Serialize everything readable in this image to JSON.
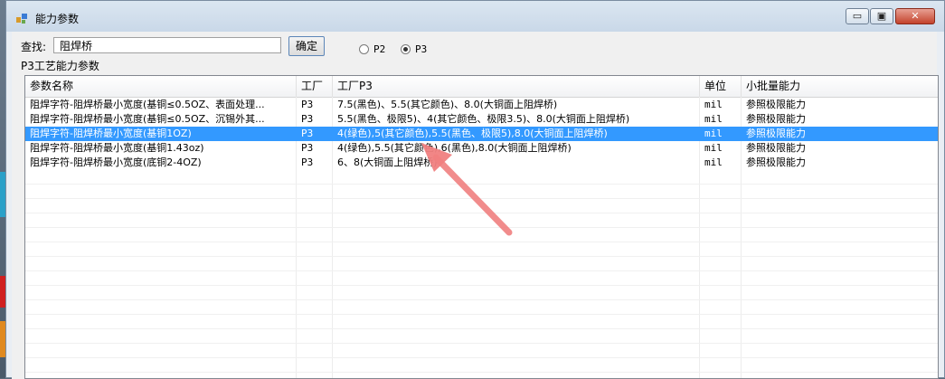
{
  "window": {
    "title": "能力参数",
    "controls": {
      "minimize": "▭",
      "maximize": "▣",
      "close": "✕"
    }
  },
  "search": {
    "label": "查找:",
    "value": "阻焊桥",
    "confirm_label": "确定"
  },
  "radios": [
    {
      "label": "P2",
      "checked": false
    },
    {
      "label": "P3",
      "checked": true
    }
  ],
  "section_label": "P3工艺能力参数",
  "table": {
    "columns": [
      "参数名称",
      "工厂",
      "工厂P3",
      "单位",
      "小批量能力"
    ],
    "rows": [
      [
        "阻焊字符-阻焊桥最小宽度(基铜≤0.5OZ、表面处理...",
        "P3",
        "7.5(黑色)、5.5(其它颜色)、8.0(大铜面上阻焊桥)",
        "mil",
        "参照极限能力"
      ],
      [
        "阻焊字符-阻焊桥最小宽度(基铜≤0.5OZ、沉锡外其...",
        "P3",
        "5.5(黑色、极限5)、4(其它颜色、极限3.5)、8.0(大铜面上阻焊桥)",
        "mil",
        "参照极限能力"
      ],
      [
        "阻焊字符-阻焊桥最小宽度(基铜1OZ)",
        "P3",
        "4(绿色),5(其它颜色),5.5(黑色、极限5),8.0(大铜面上阻焊桥)",
        "mil",
        "参照极限能力"
      ],
      [
        "阻焊字符-阻焊桥最小宽度(基铜1.43oz)",
        "P3",
        "4(绿色),5.5(其它颜色),6(黑色),8.0(大铜面上阻焊桥)",
        "mil",
        "参照极限能力"
      ],
      [
        "阻焊字符-阻焊桥最小宽度(底铜2-4OZ)",
        "P3",
        "6、8(大铜面上阻焊桥)",
        "mil",
        "参照极限能力"
      ]
    ],
    "selected_row_index": 2
  },
  "colors": {
    "selection": "#3399ff",
    "annotation_arrow": "#f08080"
  }
}
